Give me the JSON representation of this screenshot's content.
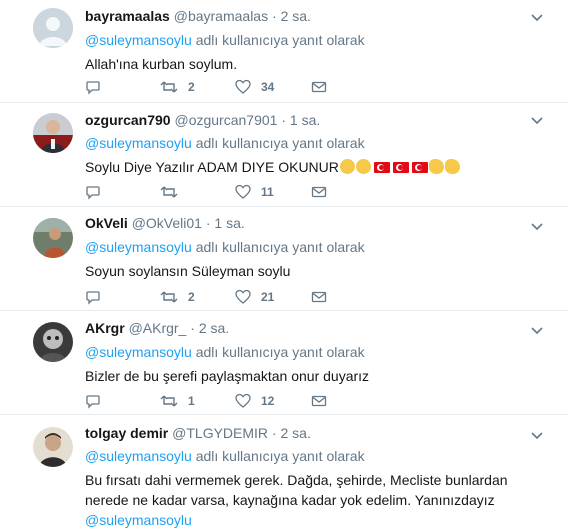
{
  "colors": {
    "accent": "#1da1f2",
    "muted": "#657786",
    "text": "#14171a",
    "divider": "#e6ecf0"
  },
  "tweets": [
    {
      "display_name": "bayramaalas",
      "screen_name": "@bayramaalas",
      "time": "2 sa.",
      "reply_prefix": "",
      "reply_to": "@suleymansoylu",
      "reply_suffix": " adlı kullanıcıya yanıt olarak",
      "text": "Allah'ına kurban soylum.",
      "retweets": "2",
      "likes": "34",
      "avatar": "default-avatar"
    },
    {
      "display_name": "ozgurcan790",
      "screen_name": "@ozgurcan7901",
      "time": "1 sa.",
      "reply_to": "@suleymansoylu",
      "reply_suffix": " adlı kullanıcıya yanıt olarak",
      "text": "Soylu Diye Yazılır ADAM DIYE OKUNUR",
      "emojis": [
        "flexed-biceps",
        "flexed-biceps",
        "turkey-flag",
        "turkey-flag",
        "turkey-flag",
        "clapping-hands",
        "clapping-hands"
      ],
      "retweets": "",
      "likes": "11"
    },
    {
      "display_name": "OkVeli",
      "screen_name": "@OkVeli01",
      "time": "1 sa.",
      "reply_to": "@suleymansoylu",
      "reply_suffix": " adlı kullanıcıya yanıt olarak",
      "text": "Soyun soylansın Süleyman soylu",
      "retweets": "2",
      "likes": "21"
    },
    {
      "display_name": "AKrgr",
      "screen_name": "@AKrgr_",
      "time": "2 sa.",
      "reply_to": "@suleymansoylu",
      "reply_suffix": " adlı kullanıcıya yanıt olarak",
      "text": "Bizler de bu şerefi paylaşmaktan onur duyarız",
      "retweets": "1",
      "likes": "12"
    },
    {
      "display_name": "tolgay demir",
      "screen_name": "@TLGYDEMIR",
      "time": "2 sa.",
      "reply_to": "@suleymansoylu",
      "reply_suffix": " adlı kullanıcıya yanıt olarak",
      "text": "Bu fırsatı dahi vermemek gerek. Dağda, şehirde, Mecliste bunlardan nerede ne kadar varsa, kaynağına kadar yok edelim. Yanınızdayız ",
      "text_mention": "@suleymansoylu"
    }
  ],
  "separator": "·"
}
